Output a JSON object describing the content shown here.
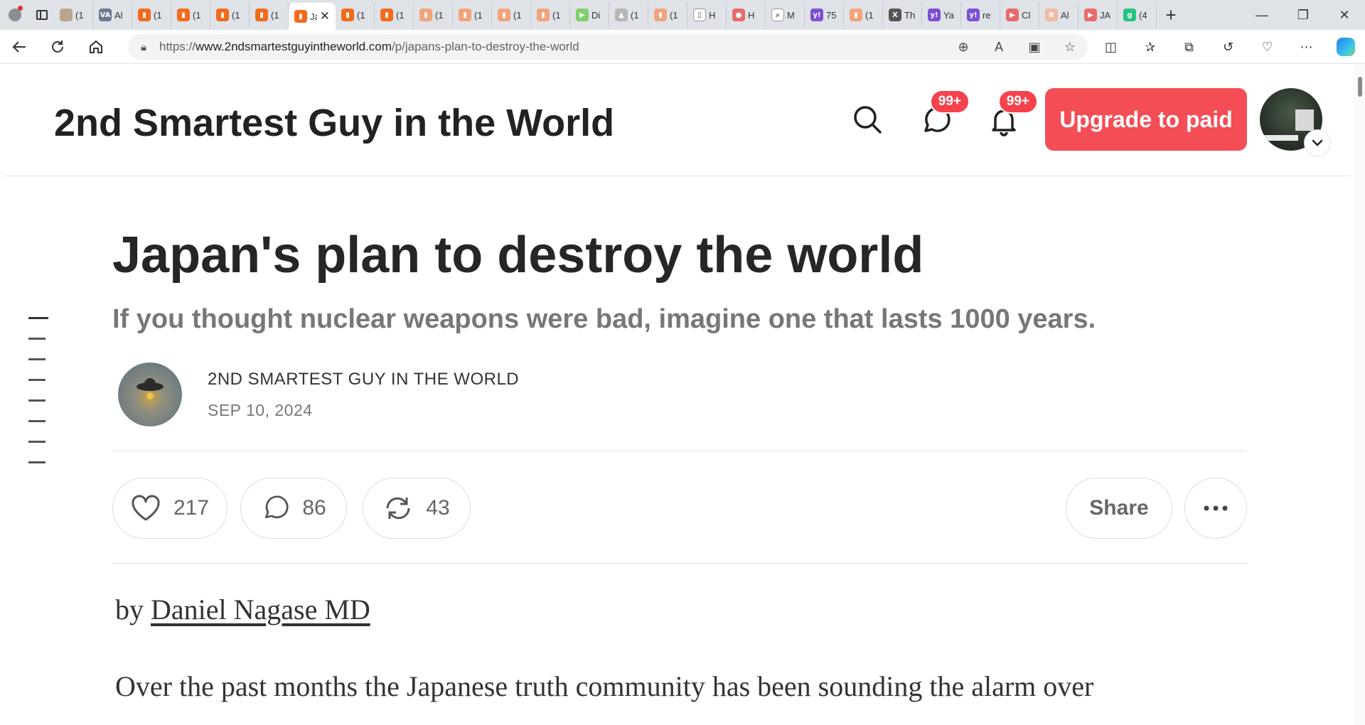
{
  "browser": {
    "tabs": [
      {
        "label": "(1",
        "color": "#b9a58c",
        "glyph": ""
      },
      {
        "label": "Al",
        "color": "#6b7a8f",
        "glyph": "VA"
      },
      {
        "label": "(1",
        "color": "#f26b1d",
        "glyph": "▮"
      },
      {
        "label": "(1",
        "color": "#f26b1d",
        "glyph": "▮"
      },
      {
        "label": "(1",
        "color": "#f26b1d",
        "glyph": "▮"
      },
      {
        "label": "(1",
        "color": "#f26b1d",
        "glyph": "▮"
      }
    ],
    "active_tab": {
      "label": "Ja",
      "color": "#f26b1d",
      "glyph": "▮"
    },
    "tabs_after": [
      {
        "label": "(1",
        "color": "#f26b1d",
        "glyph": "▮"
      },
      {
        "label": "(1",
        "color": "#f26b1d",
        "glyph": "▮"
      },
      {
        "label": "(1",
        "color": "#f2a37a",
        "glyph": "▮"
      },
      {
        "label": "(1",
        "color": "#f2a37a",
        "glyph": "▮"
      },
      {
        "label": "(1",
        "color": "#f2a37a",
        "glyph": "▮"
      },
      {
        "label": "(1",
        "color": "#f2a37a",
        "glyph": "▮"
      },
      {
        "label": "Di",
        "color": "#7dcf6a",
        "glyph": "▶"
      },
      {
        "label": "(1",
        "color": "#b7b7b7",
        "glyph": "▲"
      },
      {
        "label": "(1",
        "color": "#f2a37a",
        "glyph": "▮"
      },
      {
        "label": "H",
        "color": "#ffffff",
        "glyph": "▯"
      },
      {
        "label": "H",
        "color": "#e86b6b",
        "glyph": "●"
      },
      {
        "label": "M",
        "color": "#ffffff",
        "glyph": "⌕"
      },
      {
        "label": "75",
        "color": "#7b4fd6",
        "glyph": "y!"
      },
      {
        "label": "(1",
        "color": "#f2a37a",
        "glyph": "▮"
      },
      {
        "label": "Th",
        "color": "#555555",
        "glyph": "X"
      },
      {
        "label": "Ya",
        "color": "#7b4fd6",
        "glyph": "y!"
      },
      {
        "label": "re",
        "color": "#7b4fd6",
        "glyph": "y!"
      },
      {
        "label": "Cl",
        "color": "#e86b6b",
        "glyph": "▶"
      },
      {
        "label": "Al",
        "color": "#f2b9a0",
        "glyph": "B"
      },
      {
        "label": "JA",
        "color": "#e86b6b",
        "glyph": "▶"
      },
      {
        "label": "(4",
        "color": "#26c281",
        "glyph": "g"
      }
    ],
    "url_prefix": "https://",
    "url_host": "www.2ndsmartestguyintheworld.com",
    "url_path": "/p/japans-plan-to-destroy-the-world"
  },
  "site": {
    "title": "2nd Smartest Guy in the World",
    "chat_badge": "99+",
    "bell_badge": "99+",
    "upgrade_label": "Upgrade to paid"
  },
  "post": {
    "title": "Japan's plan to destroy the world",
    "subtitle": "If you thought nuclear weapons were bad, imagine one that lasts 1000 years.",
    "author": "2ND SMARTEST GUY IN THE WORLD",
    "date": "SEP 10, 2024",
    "likes": "217",
    "comments": "86",
    "restacks": "43",
    "share_label": "Share",
    "byline_prefix": "by ",
    "byline_author": "Daniel Nagase MD",
    "first_line": "Over the past months the Japanese truth community has been sounding the alarm over"
  }
}
